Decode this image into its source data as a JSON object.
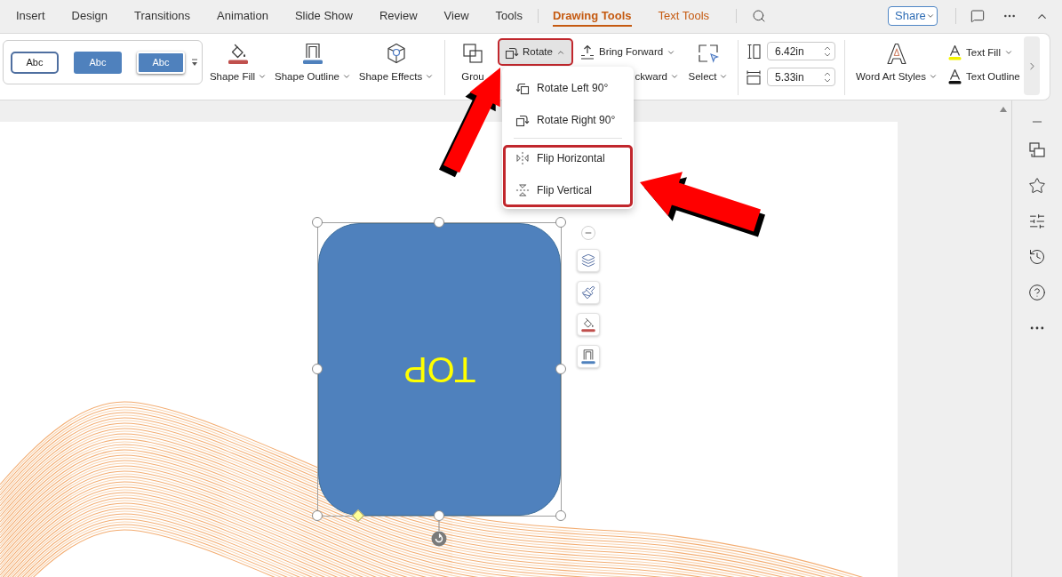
{
  "menu_tabs": [
    {
      "label": "Insert",
      "kind": "standard",
      "selected": false
    },
    {
      "label": "Design",
      "kind": "standard",
      "selected": false
    },
    {
      "label": "Transitions",
      "kind": "standard",
      "selected": false
    },
    {
      "label": "Animation",
      "kind": "standard",
      "selected": false
    },
    {
      "label": "Slide Show",
      "kind": "standard",
      "selected": false
    },
    {
      "label": "Review",
      "kind": "standard",
      "selected": false
    },
    {
      "label": "View",
      "kind": "standard",
      "selected": false
    },
    {
      "label": "Tools",
      "kind": "standard",
      "selected": false
    },
    {
      "label": "Drawing Tools",
      "kind": "contextual",
      "selected": true
    },
    {
      "label": "Text Tools",
      "kind": "contextual",
      "selected": false
    }
  ],
  "share_button": {
    "label": "Share"
  },
  "ribbon": {
    "style_gallery": [
      {
        "label": "Abc",
        "kind": "outline"
      },
      {
        "label": "Abc",
        "kind": "filled"
      },
      {
        "label": "Abc",
        "kind": "raised"
      }
    ],
    "shape_buttons": [
      {
        "label": "Shape Fill",
        "kind": "fill"
      },
      {
        "label": "Shape Outline",
        "kind": "outline"
      },
      {
        "label": "Shape Effects",
        "kind": "effects"
      }
    ],
    "group_button": {
      "label": "Grou"
    },
    "rotate_button": {
      "label": "Rotate",
      "expanded": true,
      "outlined": true
    },
    "bring_forward_button": {
      "label": "Bring Forward"
    },
    "send_backward_button": {
      "label": "ckward"
    },
    "select_button": {
      "label": "Select"
    },
    "size_fields": [
      {
        "kind": "height",
        "value": "6.42in"
      },
      {
        "kind": "width",
        "value": "5.33in"
      }
    ],
    "word_art_button": {
      "label": "Word Art Styles"
    },
    "text_buttons": [
      {
        "label": "Text Fill",
        "kind": "fill",
        "dropdown": true
      },
      {
        "label": "Text Outline",
        "kind": "outline",
        "dropdown": false
      }
    ]
  },
  "rotate_menu": {
    "groups": [
      {
        "outlined": false,
        "items": [
          {
            "label": "Rotate Left 90°",
            "kind": "rotate-left"
          },
          {
            "label": "Rotate Right 90°",
            "kind": "rotate-right"
          }
        ]
      },
      {
        "outlined": true,
        "items": [
          {
            "label": "Flip Horizontal",
            "kind": "flip-horizontal"
          },
          {
            "label": "Flip Vertical",
            "kind": "flip-vertical"
          }
        ]
      }
    ]
  },
  "slide": {
    "shape": {
      "text": "TOP",
      "flipped": true,
      "selected": true
    }
  }
}
